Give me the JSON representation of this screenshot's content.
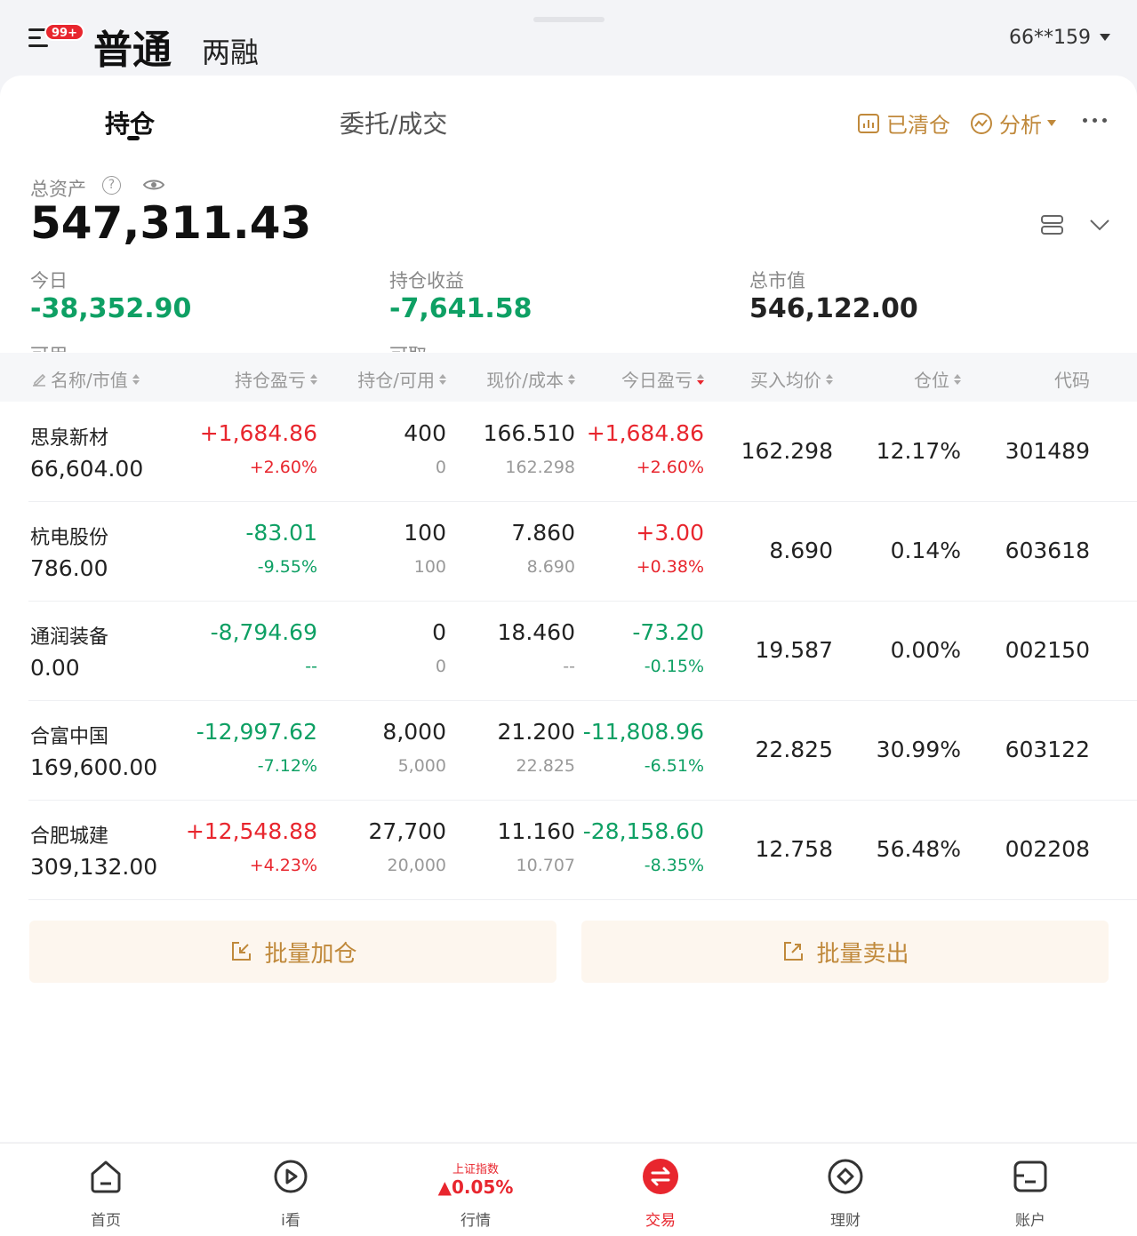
{
  "top": {
    "badge": "99+",
    "tab_normal": "普通",
    "tab_margin": "两融",
    "account": "66**159"
  },
  "tabs": {
    "holdings": "持仓",
    "orders": "委托/成交"
  },
  "tools": {
    "cleared": "已清仓",
    "analysis": "分析"
  },
  "summary": {
    "total_label": "总资产",
    "total_value": "547,311.43",
    "today_label": "今日",
    "today_value": "-38,352.90",
    "pnl_label": "持仓收益",
    "pnl_value": "-7,641.58",
    "mv_label": "总市值",
    "mv_value": "546,122.00",
    "cut_label1": "可用",
    "cut_label2": "可取"
  },
  "columns": {
    "name": "名称/市值",
    "pnl": "持仓盈亏",
    "qty": "持仓/可用",
    "price": "现价/成本",
    "today": "今日盈亏",
    "avg": "买入均价",
    "weight": "仓位",
    "code": "代码"
  },
  "rows": [
    {
      "name": "思泉新材",
      "mv": "66,604.00",
      "pnl": "+1,684.86",
      "pnl_pct": "+2.60%",
      "pnl_dir": "up",
      "qty": "400",
      "avail": "0",
      "price": "166.510",
      "cost": "162.298",
      "today": "+1,684.86",
      "today_pct": "+2.60%",
      "today_dir": "up",
      "avg": "162.298",
      "weight": "12.17%",
      "code": "301489"
    },
    {
      "name": "杭电股份",
      "mv": "786.00",
      "pnl": "-83.01",
      "pnl_pct": "-9.55%",
      "pnl_dir": "down",
      "qty": "100",
      "avail": "100",
      "price": "7.860",
      "cost": "8.690",
      "today": "+3.00",
      "today_pct": "+0.38%",
      "today_dir": "up",
      "avg": "8.690",
      "weight": "0.14%",
      "code": "603618"
    },
    {
      "name": "通润装备",
      "mv": "0.00",
      "pnl": "-8,794.69",
      "pnl_pct": "--",
      "pnl_dir": "down",
      "qty": "0",
      "avail": "0",
      "price": "18.460",
      "cost": "--",
      "today": "-73.20",
      "today_pct": "-0.15%",
      "today_dir": "down",
      "avg": "19.587",
      "weight": "0.00%",
      "code": "002150"
    },
    {
      "name": "合富中国",
      "mv": "169,600.00",
      "pnl": "-12,997.62",
      "pnl_pct": "-7.12%",
      "pnl_dir": "down",
      "qty": "8,000",
      "avail": "5,000",
      "price": "21.200",
      "cost": "22.825",
      "today": "-11,808.96",
      "today_pct": "-6.51%",
      "today_dir": "down",
      "avg": "22.825",
      "weight": "30.99%",
      "code": "603122"
    },
    {
      "name": "合肥城建",
      "mv": "309,132.00",
      "pnl": "+12,548.88",
      "pnl_pct": "+4.23%",
      "pnl_dir": "up",
      "qty": "27,700",
      "avail": "20,000",
      "price": "11.160",
      "cost": "10.707",
      "today": "-28,158.60",
      "today_pct": "-8.35%",
      "today_dir": "down",
      "avg": "12.758",
      "weight": "56.48%",
      "code": "002208"
    }
  ],
  "actions": {
    "batch_add": "批量加仓",
    "batch_sell": "批量卖出"
  },
  "nav": {
    "home": "首页",
    "watch": "i看",
    "index_name": "上证指数",
    "index_change": "▲0.05%",
    "market": "行情",
    "trade": "交易",
    "wealth": "理财",
    "account": "账户"
  },
  "colors": {
    "up": "#e8262e",
    "down": "#0ea064",
    "accent": "#c0893b"
  }
}
